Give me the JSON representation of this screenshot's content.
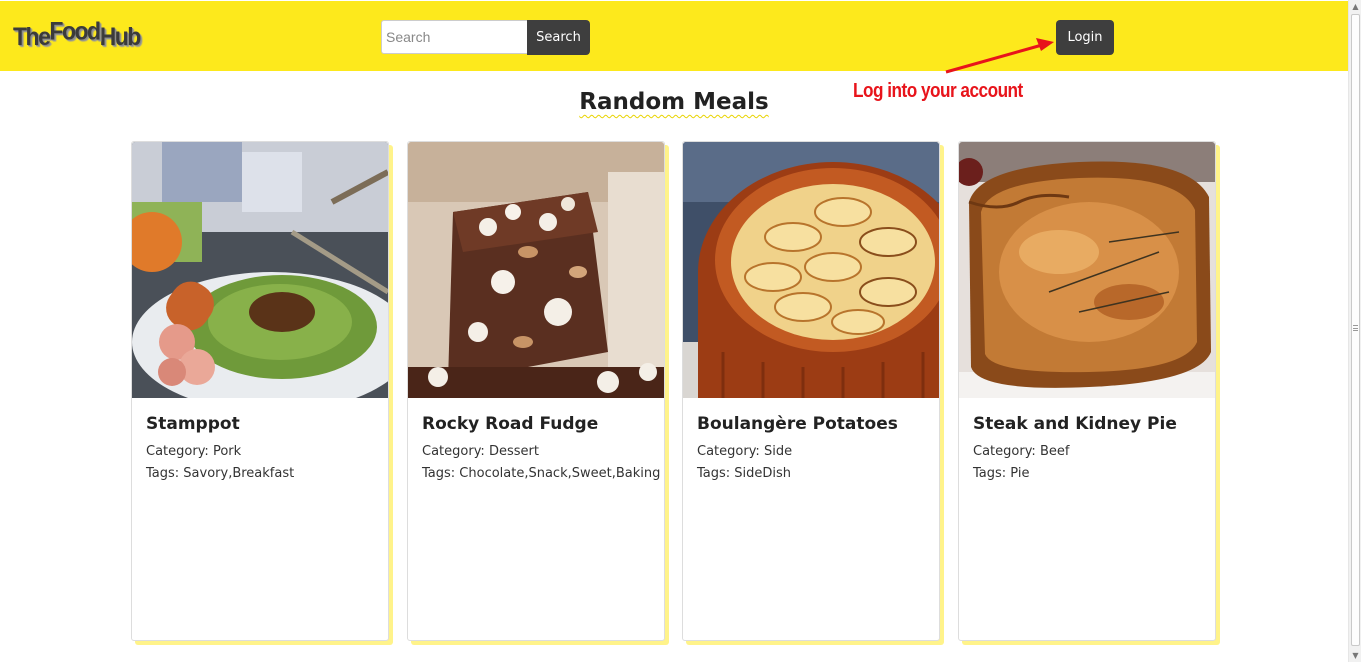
{
  "header": {
    "logo_word1": "The",
    "logo_word2": "Food",
    "logo_word3": "Hub",
    "search_placeholder": "Search",
    "search_button": "Search",
    "login_button": "Login",
    "background_color": "#fde91c"
  },
  "annotation": {
    "text": "Log into your account",
    "color": "#e8141b"
  },
  "main": {
    "title": "Random Meals",
    "cards": [
      {
        "title": "Stamppot",
        "category": "Category: Pork",
        "tags": "Tags: Savory,Breakfast",
        "image": "stamppot-image"
      },
      {
        "title": "Rocky Road Fudge",
        "category": "Category: Dessert",
        "tags": "Tags: Chocolate,Snack,Sweet,Baking",
        "image": "rocky-road-fudge-image"
      },
      {
        "title": "Boulangère Potatoes",
        "category": "Category: Side",
        "tags": "Tags: SideDish",
        "image": "boulangere-potatoes-image"
      },
      {
        "title": "Steak and Kidney Pie",
        "category": "Category: Beef",
        "tags": "Tags: Pie",
        "image": "steak-kidney-pie-image"
      }
    ]
  },
  "colors": {
    "button_dark": "#3e3e3e",
    "card_shadow": "#fff38a"
  }
}
